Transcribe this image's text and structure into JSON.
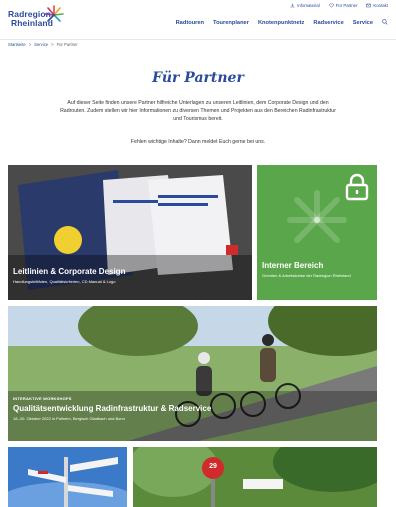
{
  "logo": {
    "line1": "Radregion",
    "line2": "Rheinland"
  },
  "toplinks": [
    {
      "label": "Infomaterial",
      "icon": "download-icon"
    },
    {
      "label": "Für Partner",
      "icon": "heart-icon"
    },
    {
      "label": "Kontakt",
      "icon": "mail-icon"
    }
  ],
  "nav": [
    "Radtouren",
    "Tourenplaner",
    "Knotenpunktnetz",
    "Radservice",
    "Service"
  ],
  "breadcrumb": {
    "home": "Startseite",
    "mid": "Service",
    "current": "Für Partner",
    "sep": ">"
  },
  "page": {
    "title": "Für Partner",
    "intro": "Auf dieser Seite finden unsere Partner hilfreiche Unterlagen zu unseren Leitlinien, dem Corporate Design und den Radrouten. Zudem stellen wir hier Informationen zu diversen Themen und Projekten aus den Bereichen Radinfrastruktur und Tourismus bereit.",
    "ask": "Fehlen wichtige Inhalte? Dann meldet Euch gerne bei uns."
  },
  "tiles": {
    "t1": {
      "title": "Leitlinien & Corporate Design",
      "sub": "Handlungsleitfäden, Qualitätskriterien, CD Manual & Logo"
    },
    "t2": {
      "title": "Interner Bereich",
      "sub": "Gremien & Arbeitskreise der Radregion Rheinland"
    },
    "t3": {
      "kicker": "Interaktive Workshops",
      "title": "Qualitätsentwicklung Radinfrastruktur & Radservice",
      "sub": "18.-20. Oktober 2022 in Pulheim, Bergisch Gladbach und Bonn"
    },
    "t5": {
      "sign": "29"
    }
  },
  "colors": {
    "brand": "#2a4a9a",
    "green": "#5aa64a"
  }
}
